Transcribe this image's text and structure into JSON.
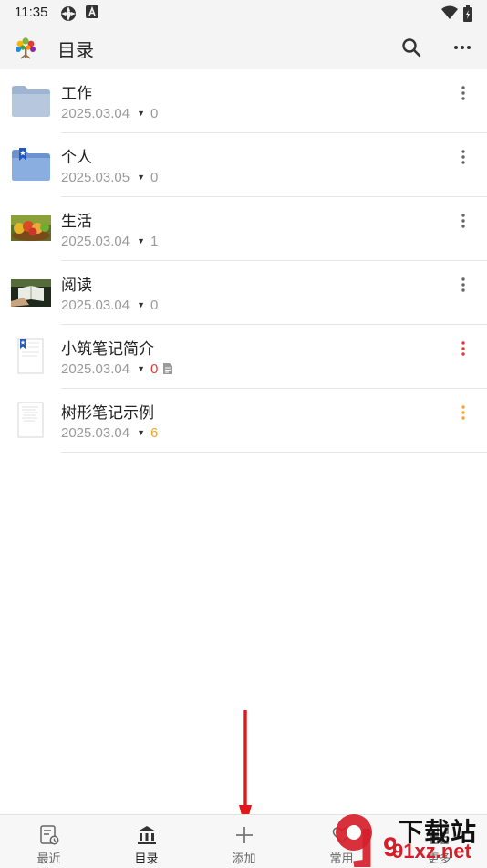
{
  "status_bar": {
    "time": "11:35"
  },
  "app_bar": {
    "title": "目录"
  },
  "items": [
    {
      "title": "工作",
      "date": "2025.03.04",
      "count": "0",
      "count_color": "#9a9a9a",
      "more_color": "#666666",
      "icon": "folder-icon"
    },
    {
      "title": "个人",
      "date": "2025.03.05",
      "count": "0",
      "count_color": "#9a9a9a",
      "more_color": "#666666",
      "icon": "bookmarked-folder-icon"
    },
    {
      "title": "生活",
      "date": "2025.03.04",
      "count": "1",
      "count_color": "#9a9a9a",
      "more_color": "#666666",
      "icon": "fruit-photo-icon"
    },
    {
      "title": "阅读",
      "date": "2025.03.04",
      "count": "0",
      "count_color": "#9a9a9a",
      "more_color": "#666666",
      "icon": "reading-photo-icon"
    },
    {
      "title": "小筑笔记简介",
      "date": "2025.03.04",
      "count": "0",
      "count_color": "#e53935",
      "more_color": "#e53935",
      "icon": "bookmarked-document-icon"
    },
    {
      "title": "树形笔记示例",
      "date": "2025.03.04",
      "count": "6",
      "count_color": "#f5a623",
      "more_color": "#f5a623",
      "icon": "document-icon"
    }
  ],
  "bottom_nav": {
    "recent": "最近",
    "catalog": "目录",
    "add": "添加",
    "frequent": "常用",
    "more": "更多"
  },
  "watermark": {
    "line1": "下载站",
    "line2": "91xz.net",
    "digit": "9"
  }
}
